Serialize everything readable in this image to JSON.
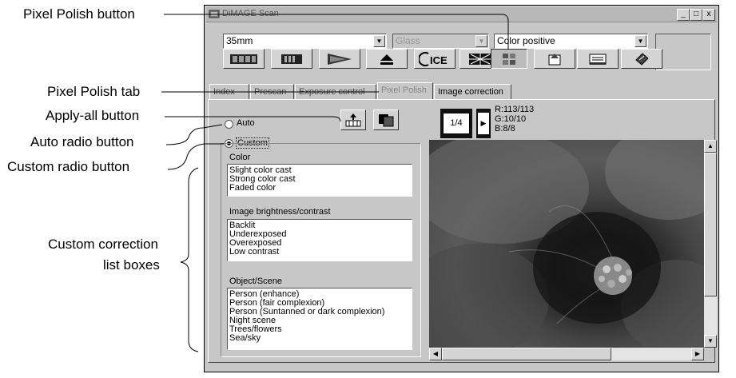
{
  "callouts": {
    "pixel_polish_button": "Pixel Polish button",
    "pixel_polish_tab": "Pixel Polish tab",
    "apply_all_button": "Apply-all button",
    "auto_radio_button": "Auto radio button",
    "custom_radio_button": "Custom radio button",
    "custom_list_boxes_line1": "Custom correction",
    "custom_list_boxes_line2": "list boxes"
  },
  "window": {
    "title": "DiMAGE Scan",
    "minimize": "_",
    "maximize": "□",
    "close": "x"
  },
  "toolbar": {
    "film_type": "35mm",
    "holder": "Glass",
    "color_mode": "Color positive"
  },
  "tabs": [
    "Index",
    "Prescan",
    "Exposure control",
    "Pixel Polish",
    "Image correction"
  ],
  "pixel_polish": {
    "auto_label": "Auto",
    "custom_label": "Custom",
    "frame_counter": "1/4",
    "rgb": {
      "r": "R:113/113",
      "g": "G:10/10",
      "b": "B:8/8"
    },
    "groups": [
      {
        "title": "Color",
        "items": [
          "Slight color cast",
          "Strong color cast",
          "Faded color"
        ]
      },
      {
        "title": "Image brightness/contrast",
        "items": [
          "Backlit",
          "Underexposed",
          "Overexposed",
          "Low contrast"
        ]
      },
      {
        "title": "Object/Scene",
        "items": [
          "Person (enhance)",
          "Person (fair complexion)",
          "Person (Suntanned or dark complexion)",
          "Night scene",
          "Trees/flowers",
          "Sea/sky"
        ]
      }
    ]
  },
  "icons": [
    "index-scan-icon",
    "prescan-icon",
    "scan-icon",
    "eject-icon",
    "ice-icon",
    "grain-dissolver-icon",
    "pixel-polish-icon",
    "preferences-icon",
    "job-icon",
    "help-icon",
    "apply-all-icon",
    "compare-icon",
    "film-frame-icon",
    "next-frame-icon"
  ],
  "colors": {
    "window_bg": "#c7c7c7",
    "callout_line": "#000000",
    "list_bg": "#ffffff"
  }
}
